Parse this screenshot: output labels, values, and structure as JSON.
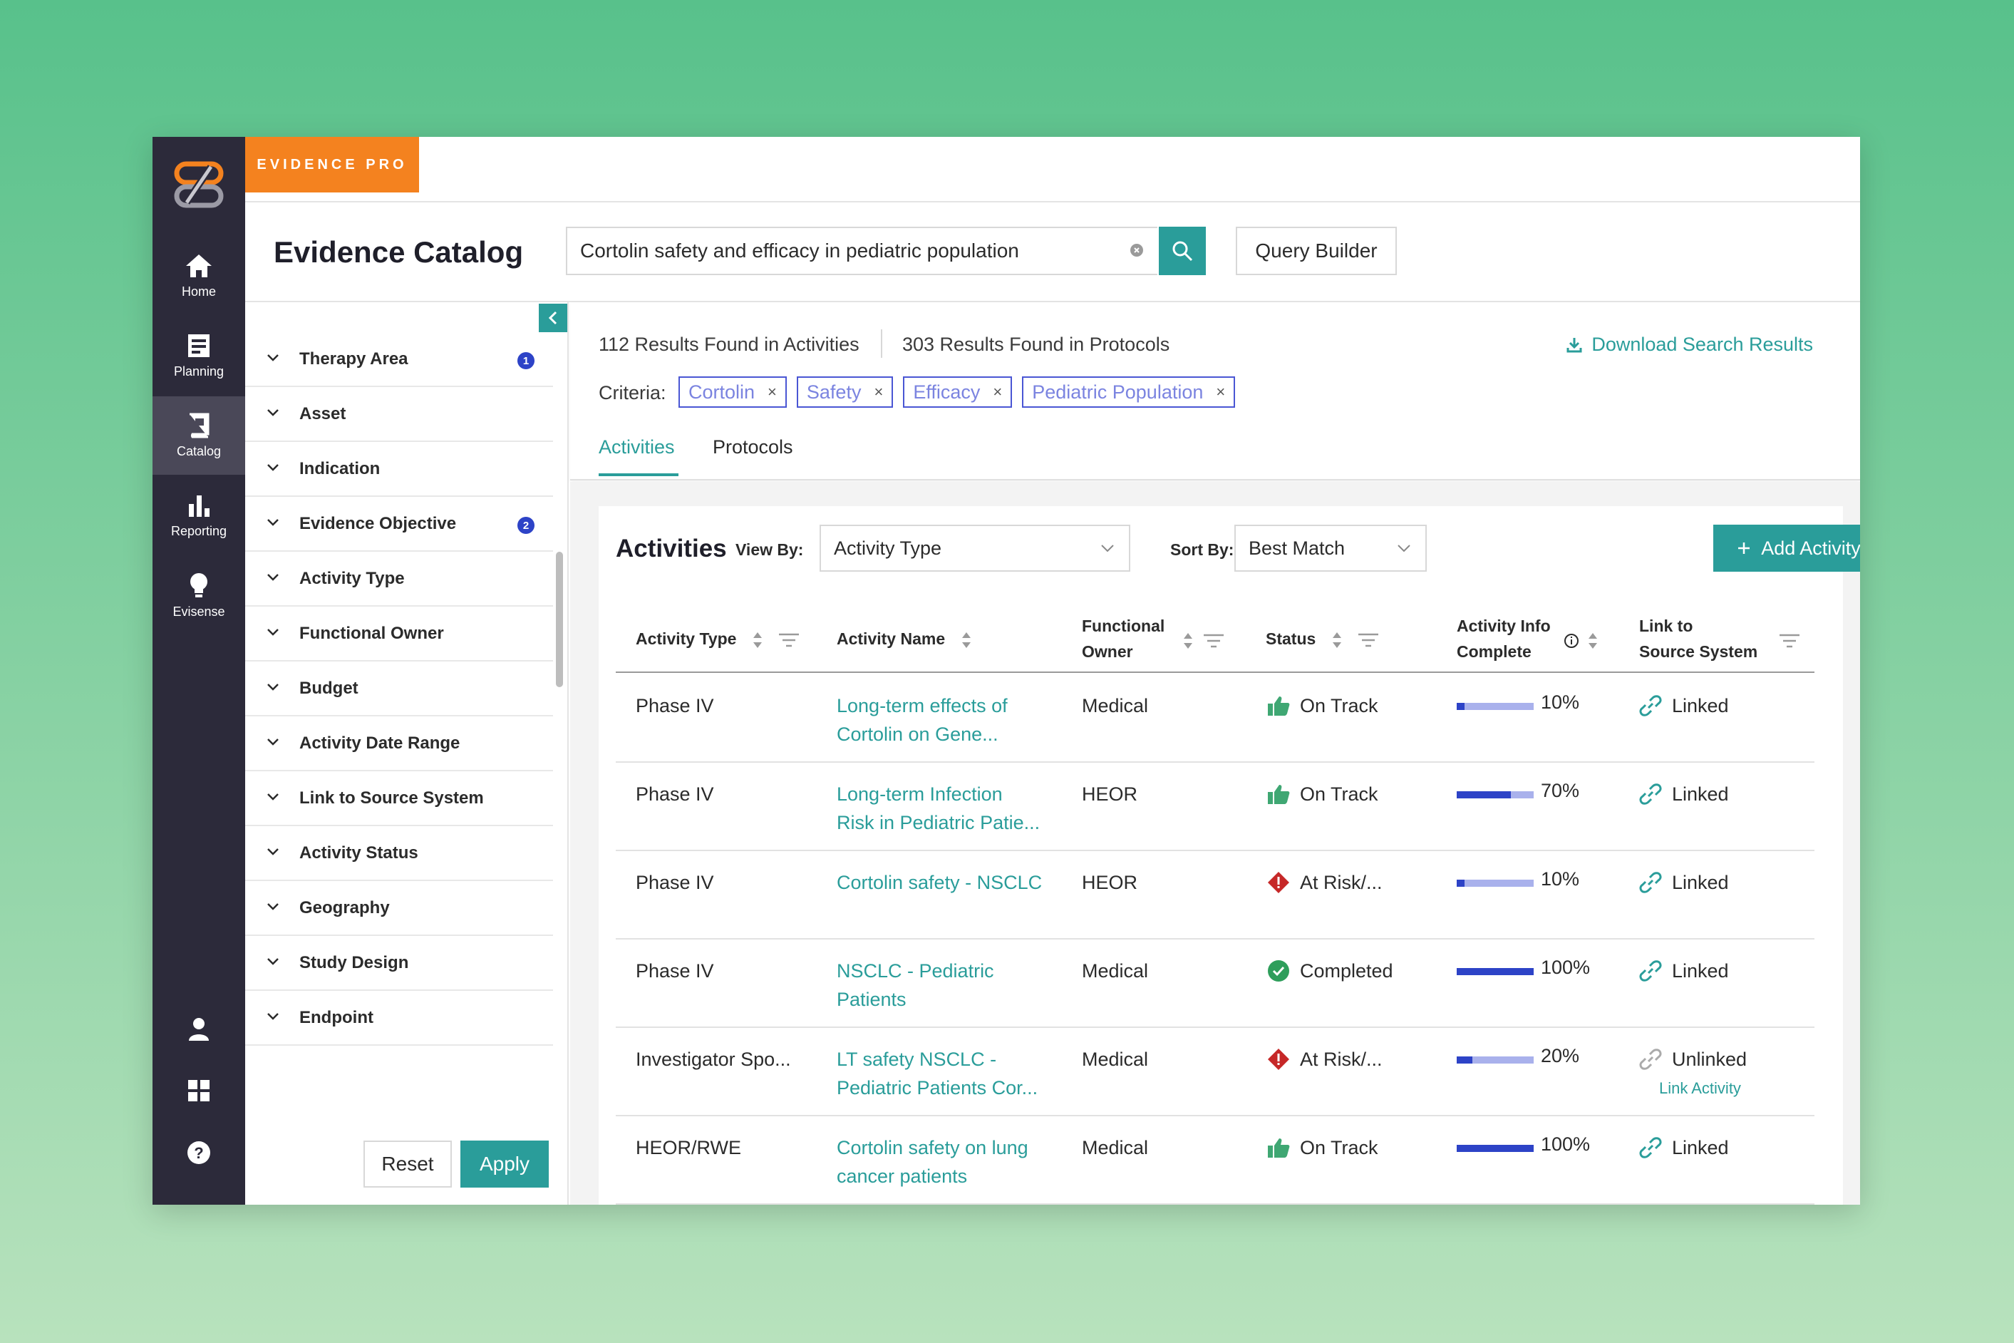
{
  "brand": {
    "label": "EVIDENCE PRO",
    "color": "#f4821f"
  },
  "nav": {
    "items": [
      {
        "label": "Home",
        "icon": "home-icon"
      },
      {
        "label": "Planning",
        "icon": "planning-icon"
      },
      {
        "label": "Catalog",
        "icon": "book-icon",
        "active": true
      },
      {
        "label": "Reporting",
        "icon": "bar-chart-icon"
      },
      {
        "label": "Evisense",
        "icon": "lightbulb-icon"
      }
    ],
    "bottom_icons": [
      "user-icon",
      "grid-icon",
      "help-icon"
    ]
  },
  "header": {
    "title": "Evidence Catalog",
    "search_value": "Cortolin safety and efficacy in pediatric population",
    "query_builder_label": "Query Builder"
  },
  "filters": {
    "items": [
      {
        "label": "Therapy Area",
        "badge": "1"
      },
      {
        "label": "Asset"
      },
      {
        "label": "Indication"
      },
      {
        "label": "Evidence Objective",
        "badge": "2"
      },
      {
        "label": "Activity Type"
      },
      {
        "label": "Functional Owner"
      },
      {
        "label": "Budget"
      },
      {
        "label": "Activity Date Range"
      },
      {
        "label": "Link to Source System"
      },
      {
        "label": "Activity Status"
      },
      {
        "label": "Geography"
      },
      {
        "label": "Study Design"
      },
      {
        "label": "Endpoint"
      }
    ],
    "reset_label": "Reset",
    "apply_label": "Apply"
  },
  "results": {
    "activities_count": "112 Results Found in Activities",
    "protocols_count": "303 Results Found in Protocols",
    "download_label": "Download Search Results",
    "criteria_label": "Criteria:",
    "criteria": [
      "Cortolin",
      "Safety",
      "Efficacy",
      "Pediatric Population"
    ],
    "tabs": [
      {
        "label": "Activities",
        "active": true
      },
      {
        "label": "Protocols"
      }
    ]
  },
  "activities": {
    "title": "Activities",
    "view_by_label": "View By:",
    "view_by_value": "Activity Type",
    "sort_by_label": "Sort By:",
    "sort_by_value": "Best Match",
    "add_label": "Add Activity",
    "columns": {
      "activity_type": "Activity Type",
      "activity_name": "Activity Name",
      "functional_owner_1": "Functional",
      "functional_owner_2": "Owner",
      "status": "Status",
      "info_complete_1": "Activity Info",
      "info_complete_2": "Complete",
      "link_1": "Link to",
      "link_2": "Source System"
    },
    "rows": [
      {
        "type": "Phase IV",
        "name_1": "Long-term effects of",
        "name_2": "Cortolin on Gene...",
        "owner": "Medical",
        "status": "On Track",
        "status_icon": "thumbs-up-icon",
        "complete": 0.1,
        "complete_label": "10%",
        "link": "Linked"
      },
      {
        "type": "Phase IV",
        "name_1": "Long-term Infection",
        "name_2": "Risk in Pediatric Patie...",
        "owner": "HEOR",
        "status": "On Track",
        "status_icon": "thumbs-up-icon",
        "complete": 0.7,
        "complete_label": "70%",
        "link": "Linked"
      },
      {
        "type": "Phase IV",
        "name_1": "Cortolin safety - NSCLC",
        "name_2": "",
        "owner": "HEOR",
        "status": "At Risk/...",
        "status_icon": "warning-icon",
        "complete": 0.1,
        "complete_label": "10%",
        "link": "Linked"
      },
      {
        "type": "Phase IV",
        "name_1": "NSCLC - Pediatric",
        "name_2": "Patients",
        "owner": "Medical",
        "status": "Completed",
        "status_icon": "check-circle-icon",
        "complete": 1.0,
        "complete_label": "100%",
        "link": "Linked"
      },
      {
        "type": "Investigator Spo...",
        "name_1": "LT safety NSCLC -",
        "name_2": "Pediatric Patients Cor...",
        "owner": "Medical",
        "status": "At Risk/...",
        "status_icon": "warning-icon",
        "complete": 0.2,
        "complete_label": "20%",
        "link": "Unlinked",
        "link_action": "Link Activity"
      },
      {
        "type": "HEOR/RWE",
        "name_1": "Cortolin safety on lung",
        "name_2": "cancer patients",
        "owner": "Medical",
        "status": "On Track",
        "status_icon": "thumbs-up-icon",
        "complete": 1.0,
        "complete_label": "100%",
        "link": "Linked"
      }
    ]
  },
  "colors": {
    "accent": "#2a9d9a",
    "chip": "#4a56d4",
    "progress": "#2d43c7",
    "warning": "#c62828",
    "success": "#2e9e5b"
  }
}
